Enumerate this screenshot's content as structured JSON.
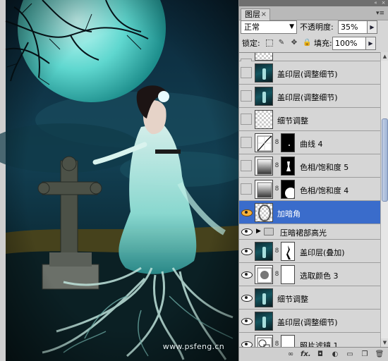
{
  "artwork": {
    "watermark": "www.psfeng.cn"
  },
  "panel": {
    "tab_label": "图层",
    "tab_close": "×",
    "blend_mode": "正常",
    "opacity_label": "不透明度:",
    "opacity_value": "35%",
    "lock_label": "锁定:",
    "fill_label": "填充:",
    "fill_value": "100%",
    "stepper_arrow": "▶",
    "dropdown_arrow": "▼",
    "folder_arrow": "▶",
    "chain_glyph": "8"
  },
  "layers": [
    {
      "name": "",
      "visible": false,
      "thumb": "checker",
      "partial": true
    },
    {
      "name": "盖印层(调整细节)",
      "visible": false,
      "thumb": "photo"
    },
    {
      "name": "盖印层(调整细节)",
      "visible": false,
      "thumb": "photo"
    },
    {
      "name": "细节调整",
      "visible": false,
      "thumb": "checker"
    },
    {
      "name": "曲线 4",
      "visible": false,
      "thumb": "adj-curves",
      "mask": "black"
    },
    {
      "name": "色相/饱和度 5",
      "visible": false,
      "thumb": "adj-levels",
      "mask": "black"
    },
    {
      "name": "色相/饱和度 4",
      "visible": false,
      "thumb": "adj-levels",
      "mask": "black"
    },
    {
      "name": "加暗角",
      "visible": true,
      "thumb": "checker-vignette",
      "selected": true
    },
    {
      "name": "压暗裙部高光",
      "visible": true,
      "group": true
    },
    {
      "name": "盖印层(叠加)",
      "visible": true,
      "thumb": "photo",
      "mask": "white"
    },
    {
      "name": "选取颜色 3",
      "visible": true,
      "thumb": "adj-selective",
      "mask": "white"
    },
    {
      "name": "细节调整",
      "visible": true,
      "thumb": "photo"
    },
    {
      "name": "盖印层(调整细节)",
      "visible": true,
      "thumb": "photo"
    },
    {
      "name": "照片滤镜 1",
      "visible": true,
      "thumb": "adj-photo",
      "mask": "white"
    }
  ],
  "icons": {
    "lock_transparent": "checkerboard-lock-icon",
    "lock_paint": "brush-lock-icon",
    "lock_move": "move-lock-icon",
    "lock_all": "padlock-icon",
    "link": "link-icon",
    "fx": "fx-icon",
    "mask": "add-mask-icon",
    "adjustment": "adjustment-layer-icon",
    "group": "new-group-icon",
    "new": "new-layer-icon",
    "trash": "trash-icon"
  }
}
